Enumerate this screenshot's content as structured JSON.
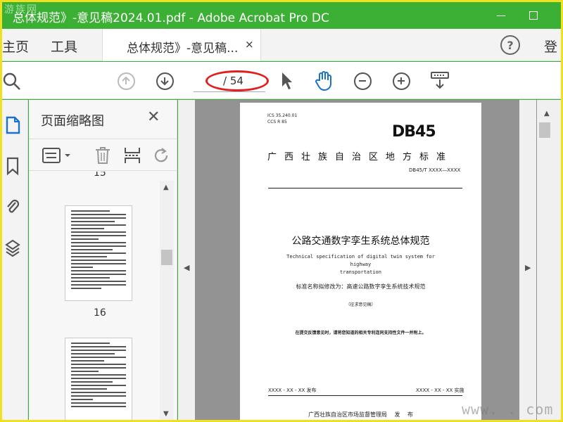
{
  "window": {
    "title": "总体规范》-意见稿2024.01.pdf - Adobe Acrobat Pro DC",
    "logo_text": "游族网"
  },
  "tabs": {
    "home": "主页",
    "tools": "工具",
    "document": "总体规范》-意见稿...",
    "close_glyph": "×",
    "login": "登"
  },
  "toolbar": {
    "current_page": "",
    "total_pages": "/ 54",
    "help_glyph": "?"
  },
  "thumbnails_panel": {
    "title": "页面缩略图",
    "close_glyph": "✕",
    "page_labels": [
      "15",
      "16"
    ]
  },
  "pdf_page": {
    "ics": "ICS  35.240.01",
    "ccs": "CCS R 85",
    "db_code": "DB45",
    "region": "广西壮族自治区地方标准",
    "standard_no": "DB45/T XXXX—XXXX",
    "title_cn": "公路交通数字孪生系统总体规范",
    "title_en_1": "Technical specification of digital twin system for highway",
    "title_en_2": "transportation",
    "rename_note": "标准名称拟修改为：高速公路数字孪生系统技术规范",
    "draft_status": "（征求意见稿）",
    "notice": "在提交反馈意见时，请将您知道的相关专利连同支持性文件一并附上。",
    "publish_date": "XXXX - XX - XX 发布",
    "implement_date": "XXXX - XX - XX 实施",
    "issuer": "广西壮族自治区市场监督管理局  发 布"
  },
  "watermark": "www.    . com",
  "colors": {
    "titlebar": "#3cb034",
    "frame": "#f0e020",
    "annotation_ellipse": "#e02020",
    "hand_tool": "#1a73c8"
  }
}
